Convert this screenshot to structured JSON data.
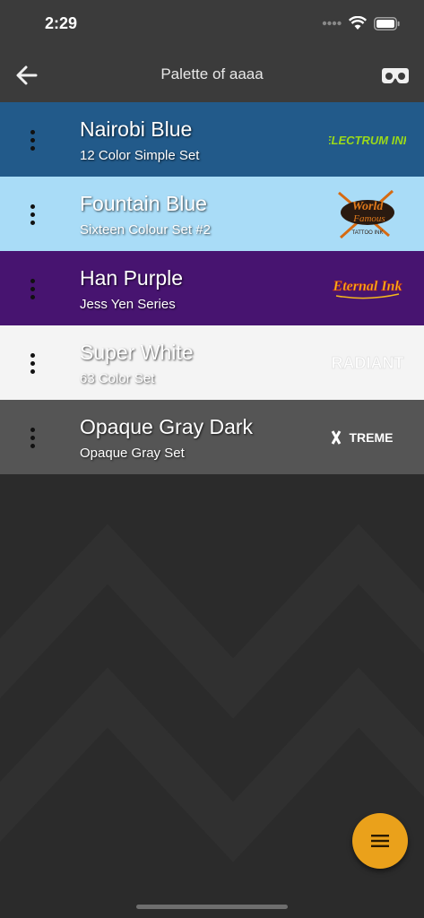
{
  "status": {
    "time": "2:29"
  },
  "header": {
    "title": "Palette of aaaa"
  },
  "palettes": [
    {
      "name": "Nairobi Blue",
      "subtitle": "12 Color Simple Set",
      "color": "#225a8a",
      "brand": "ELECTRUM INK",
      "brand_icon": "electrum-ink-logo"
    },
    {
      "name": "Fountain Blue",
      "subtitle": "Sixteen Colour Set #2",
      "color": "#a9dcf7",
      "brand": "World Famous",
      "brand_icon": "world-famous-logo"
    },
    {
      "name": "Han Purple",
      "subtitle": "Jess Yen Series",
      "color": "#471470",
      "brand": "Eternal Ink",
      "brand_icon": "eternal-ink-logo"
    },
    {
      "name": "Super White",
      "subtitle": "63 Color Set",
      "color": "#f4f4f4",
      "brand": "RADIANT",
      "brand_icon": "radiant-logo"
    },
    {
      "name": "Opaque Gray Dark",
      "subtitle": "Opaque Gray Set",
      "color": "#555555",
      "brand": "XTREME",
      "brand_icon": "xtreme-logo"
    }
  ],
  "colors": {
    "bar": "#3b3b3b",
    "background": "#2b2b2b",
    "fab": "#eaa11b"
  }
}
